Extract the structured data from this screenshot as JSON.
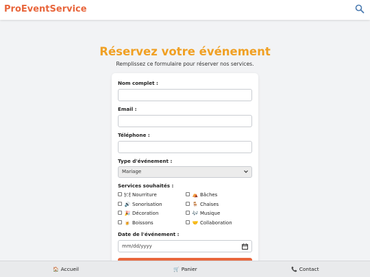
{
  "header": {
    "brand": "ProEventService",
    "search_icon": "search-icon",
    "brand_color": "#e8663c"
  },
  "main": {
    "title": "Réservez votre événement",
    "subtitle": "Remplissez ce formulaire pour réserver nos services.",
    "title_color": "#f0a024"
  },
  "form": {
    "name_label": "Nom complet :",
    "name_value": "",
    "email_label": "Email :",
    "email_value": "",
    "phone_label": "Téléphone :",
    "phone_value": "",
    "event_type_label": "Type d'événement :",
    "event_type_selected": "Mariage",
    "services_label": "Services souhaités :",
    "services": [
      {
        "label": "Nourriture",
        "icon": "utensils-icon",
        "glyph": "🍽",
        "checked": false
      },
      {
        "label": "Bâches",
        "icon": "tent-icon",
        "glyph": "⛺",
        "checked": false
      },
      {
        "label": "Sonorisation",
        "icon": "speaker-icon",
        "glyph": "🔊",
        "checked": false
      },
      {
        "label": "Chaises",
        "icon": "chair-icon",
        "glyph": "🪑",
        "checked": false
      },
      {
        "label": "Décoration",
        "icon": "party-icon",
        "glyph": "🎉",
        "checked": false
      },
      {
        "label": "Musique",
        "icon": "music-icon",
        "glyph": "🎶",
        "checked": false
      },
      {
        "label": "Boissons",
        "icon": "drink-icon",
        "glyph": "🍺",
        "checked": false
      },
      {
        "label": "Collaboration",
        "icon": "handshake-icon",
        "glyph": "🤝",
        "checked": false
      }
    ],
    "date_label": "Date de l'événement :",
    "date_placeholder": "mm/dd/yyyy",
    "submit_color": "#e8663c"
  },
  "bottom_nav": {
    "home": {
      "label": "Accueil",
      "glyph": "🏠",
      "icon": "home-icon"
    },
    "cart": {
      "label": "Panier",
      "glyph": "🛒",
      "icon": "cart-icon"
    },
    "contact": {
      "label": "Contact",
      "glyph": "📞",
      "icon": "phone-icon"
    }
  }
}
